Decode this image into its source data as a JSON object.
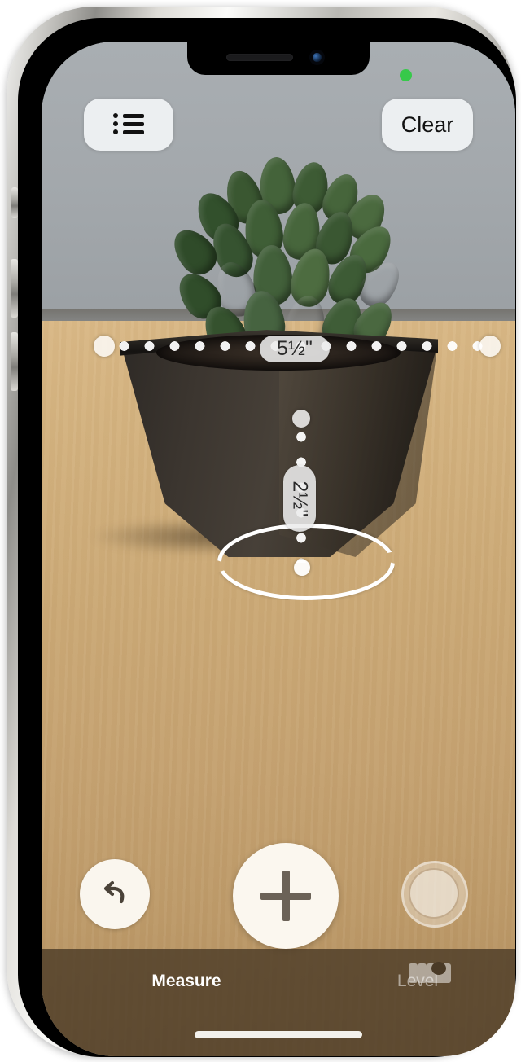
{
  "app": {
    "name": "Measure",
    "status_indicator": "camera-in-use-green-dot"
  },
  "top_controls": {
    "list_button": {
      "icon": "list-icon",
      "label": ""
    },
    "clear_button": {
      "label": "Clear"
    }
  },
  "measurements": [
    {
      "id": "horizontal",
      "value": "5½\"",
      "orientation": "horizontal",
      "number": "5",
      "fraction": "½",
      "unit": "\""
    },
    {
      "id": "vertical",
      "value": "2½\"",
      "orientation": "vertical",
      "number": "2",
      "fraction": "½",
      "unit": "\""
    }
  ],
  "bottom_controls": {
    "undo_button": {
      "icon": "undo-arrow-icon",
      "glyph": "↰"
    },
    "add_button": {
      "icon": "plus-icon"
    },
    "shutter_button": {
      "icon": "camera-shutter-icon"
    }
  },
  "tabs": [
    {
      "id": "measure",
      "label": "Measure",
      "icon": "ruler-icon",
      "active": true
    },
    {
      "id": "level",
      "label": "Level",
      "icon": "level-icon",
      "active": false
    }
  ],
  "colors": {
    "accent_white": "#ffffff",
    "label_background": "#ececec",
    "label_text": "#2a2a2a",
    "tabbar_background": "#4a3a26",
    "tab_active": "#ffffff",
    "tab_inactive": "rgba(255,255,255,0.5)",
    "pill_background": "#eceff1",
    "desk_wood": "#c9a775",
    "wall_gray": "#a5aaae",
    "pot_dark": "#3b352f",
    "plant_green": "#3c5c34",
    "status_green": "#37c94a"
  },
  "home_indicator": {
    "visible": true
  }
}
